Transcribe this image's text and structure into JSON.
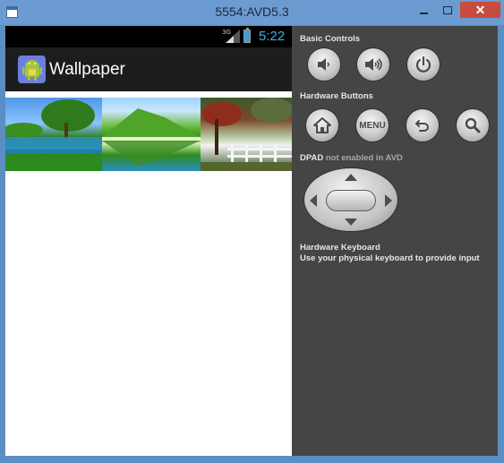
{
  "window": {
    "title": "5554:AVD5.3",
    "close_glyph": "✕"
  },
  "status_bar": {
    "network": "3G",
    "time": "5:22"
  },
  "action_bar": {
    "title": "Wallpaper"
  },
  "wallpapers": [
    {
      "name": "lake-trees-wallpaper"
    },
    {
      "name": "mountain-lake-wallpaper"
    },
    {
      "name": "autumn-fence-wallpaper"
    }
  ],
  "controls": {
    "basic_label": "Basic Controls",
    "hardware_label": "Hardware Buttons",
    "menu_label": "MENU",
    "dpad_label": "DPAD",
    "dpad_note": "not enabled in AVD",
    "keyboard_title": "Hardware Keyboard",
    "keyboard_text": "Use your physical keyboard to provide input"
  },
  "colors": {
    "accent": "#33b5e5",
    "panel": "#454545",
    "close": "#c74b3f"
  }
}
